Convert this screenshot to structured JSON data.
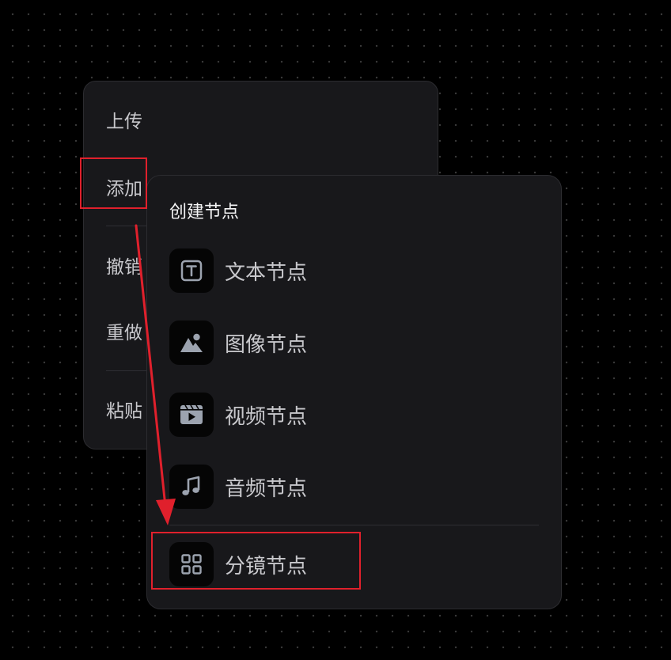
{
  "main_menu": {
    "items": [
      {
        "label": "上传"
      },
      {
        "label": "添加"
      },
      {
        "label": "撤销"
      },
      {
        "label": "重做"
      },
      {
        "label": "粘贴"
      }
    ]
  },
  "submenu": {
    "title": "创建节点",
    "items": [
      {
        "label": "文本节点",
        "icon": "text-icon"
      },
      {
        "label": "图像节点",
        "icon": "image-icon"
      },
      {
        "label": "视频节点",
        "icon": "video-icon"
      },
      {
        "label": "音频节点",
        "icon": "music-icon"
      },
      {
        "label": "分镜节点",
        "icon": "grid-icon"
      }
    ]
  },
  "colors": {
    "background": "#000000",
    "menu_bg": "#18181b",
    "icon_fg": "#9ca3af",
    "highlight": "#e0202c"
  }
}
